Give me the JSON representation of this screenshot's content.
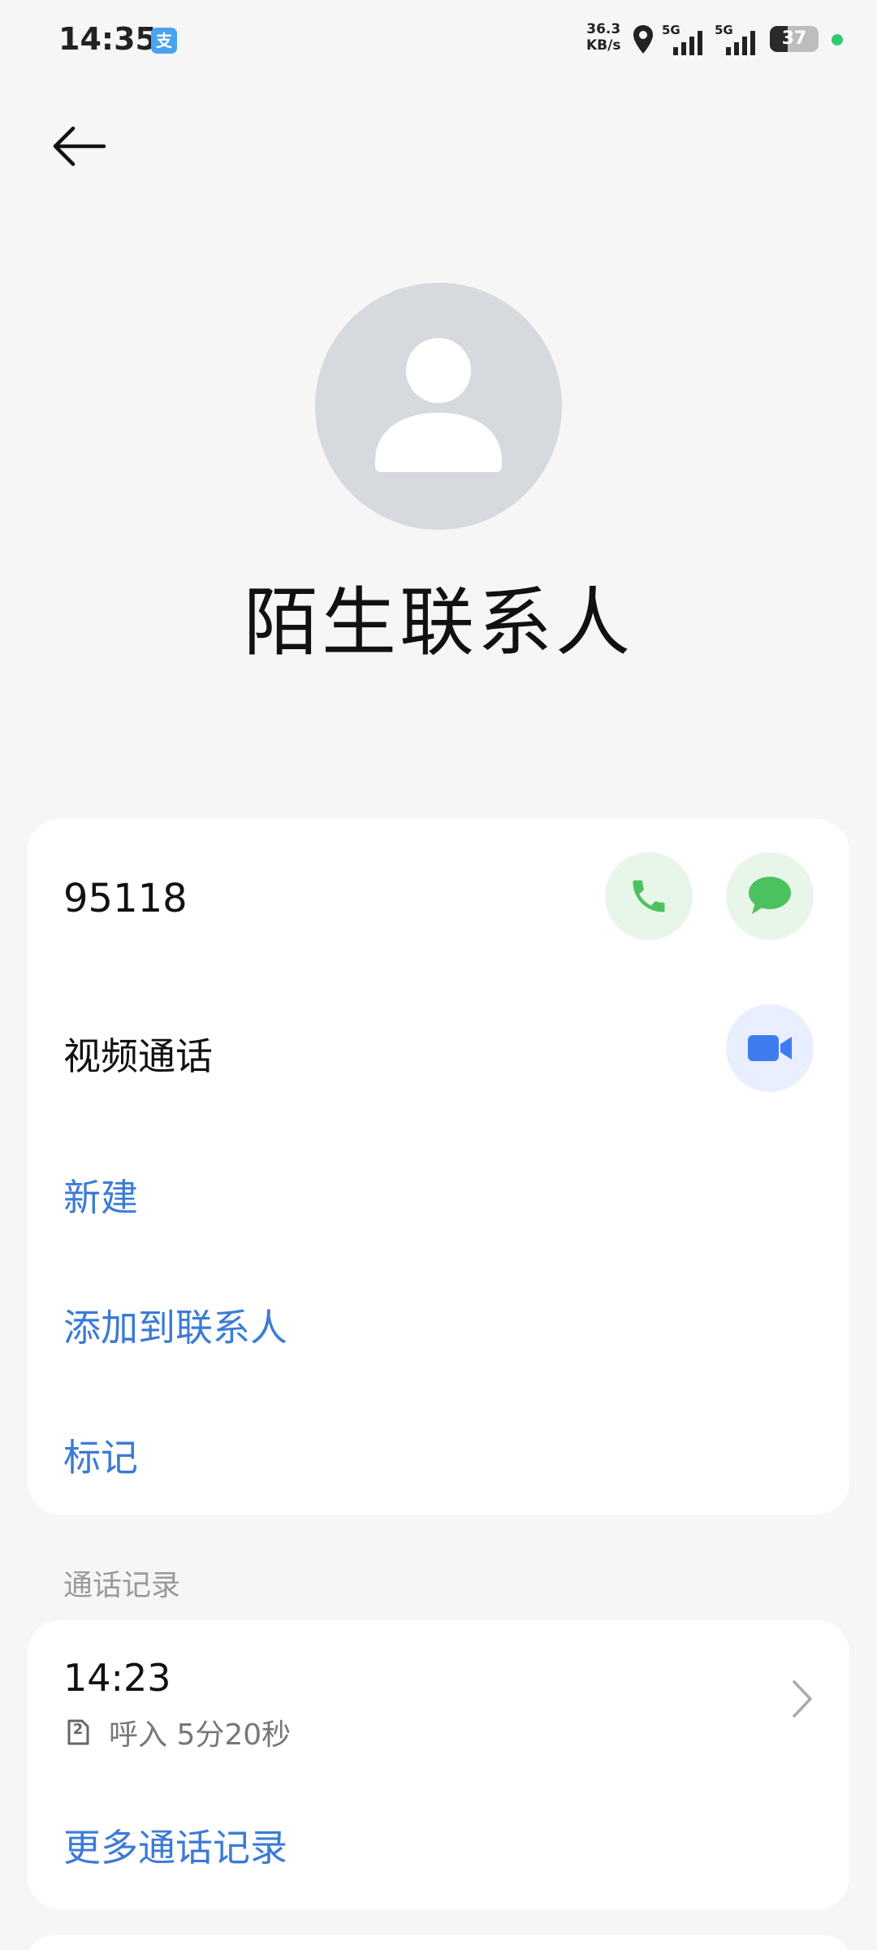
{
  "status_bar": {
    "time": "14:35",
    "app_icon": "支",
    "net_speed_value": "36.3",
    "net_speed_unit": "KB/s",
    "sim1_label": "5G",
    "sim2_label": "5G",
    "battery_level": "37",
    "battery_fraction": 0.37,
    "indicator_color": "#2ecc71"
  },
  "contact": {
    "name": "陌生联系人"
  },
  "main_card": {
    "phone_number": "95118",
    "video_call_label": "视频通话",
    "actions": {
      "new": "新建",
      "add_to_contacts": "添加到联系人",
      "mark": "标记"
    }
  },
  "call_log": {
    "section_title": "通话记录",
    "entries": [
      {
        "time": "14:23",
        "sim": "2",
        "detail": "呼入 5分20秒"
      }
    ],
    "more_label": "更多通话记录"
  },
  "colors": {
    "accent_blue": "#3c7bd6",
    "call_green": "#4cc160",
    "video_blue": "#3f7cf0",
    "avatar_gray": "#d6d9de"
  },
  "icons": {
    "back": "arrow-left-icon",
    "call": "phone-icon",
    "message": "chat-bubble-icon",
    "video": "video-camera-icon",
    "chevron": "chevron-right-icon",
    "sim": "sim-card-icon",
    "location": "location-pin-icon"
  }
}
